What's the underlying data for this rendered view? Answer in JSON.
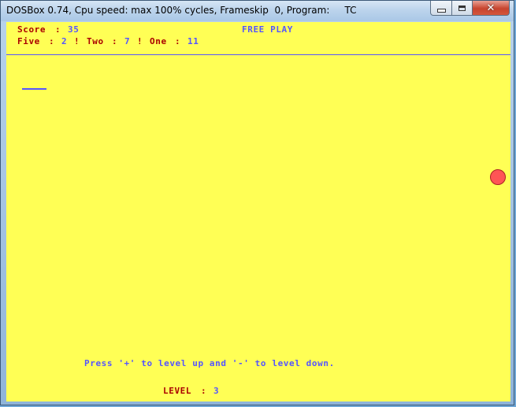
{
  "window": {
    "title": "DOSBox 0.74, Cpu speed: max 100% cycles, Frameskip  0, Program:     TC",
    "minimize_label": "",
    "maximize_label": "",
    "close_label": "✕"
  },
  "hud": {
    "score_label": "Score",
    "score_value": "35",
    "mode": "FREE PLAY",
    "five_label": "Five",
    "five_value": "2",
    "two_label": "Two",
    "two_value": "7",
    "one_label": "One",
    "one_value": "11",
    "sep_colon": ":",
    "sep_bar": "!"
  },
  "footer": {
    "hint": "Press '+' to level up and '-' to level down.",
    "level_label": "LEVEL",
    "level_value": "3"
  },
  "colors": {
    "background": "#ffff55",
    "text_red": "#aa0000",
    "text_blue": "#5555ff",
    "ball": "#ff5555",
    "paddle": "#5555ff"
  },
  "icons": {
    "minimize": "minimize-icon",
    "maximize": "maximize-icon",
    "close": "close-icon"
  }
}
